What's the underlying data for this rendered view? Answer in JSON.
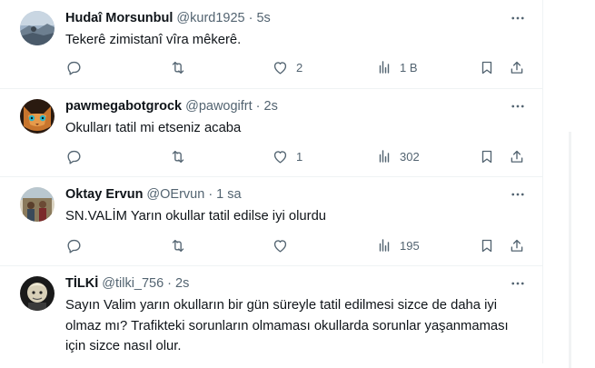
{
  "tweets": [
    {
      "name": "Hudaî Morsunbul",
      "handle": "@kurd1925",
      "separator": "·",
      "time": "5s",
      "text": "Tekerê zimistanî vîra mêkerê.",
      "likes": "2",
      "views": "1 B"
    },
    {
      "name": "pawmegabotgrock",
      "handle": "@pawogifrt",
      "separator": "·",
      "time": "2s",
      "text": "Okulları tatil mi etseniz acaba",
      "likes": "1",
      "views": "302"
    },
    {
      "name": "Oktay Ervun",
      "handle": "@OErvun",
      "separator": "·",
      "time": "1 sa",
      "text": "SN.VALİM Yarın okullar tatil edilse iyi olurdu",
      "likes": "",
      "views": "195"
    },
    {
      "name": "TİLKİ",
      "handle": "@tilki_756",
      "separator": "·",
      "time": "2s",
      "text": "Sayın Valim yarın okulların bir gün süreyle tatil edilmesi sizce de daha iyi olmaz mı? Trafikteki sorunların olmaması okullarda sorunlar yaşanmaması için sizce nasıl olur.",
      "likes": "",
      "views": ""
    }
  ],
  "icons": {
    "more": "more-horizontal-icon",
    "reply": "reply-icon",
    "retweet": "retweet-icon",
    "like": "heart-icon",
    "views": "views-chart-icon",
    "bookmark": "bookmark-icon",
    "share": "share-icon"
  },
  "colors": {
    "secondary_text": "#536471",
    "primary_text": "#0f1419",
    "divider": "#eff3f4"
  }
}
